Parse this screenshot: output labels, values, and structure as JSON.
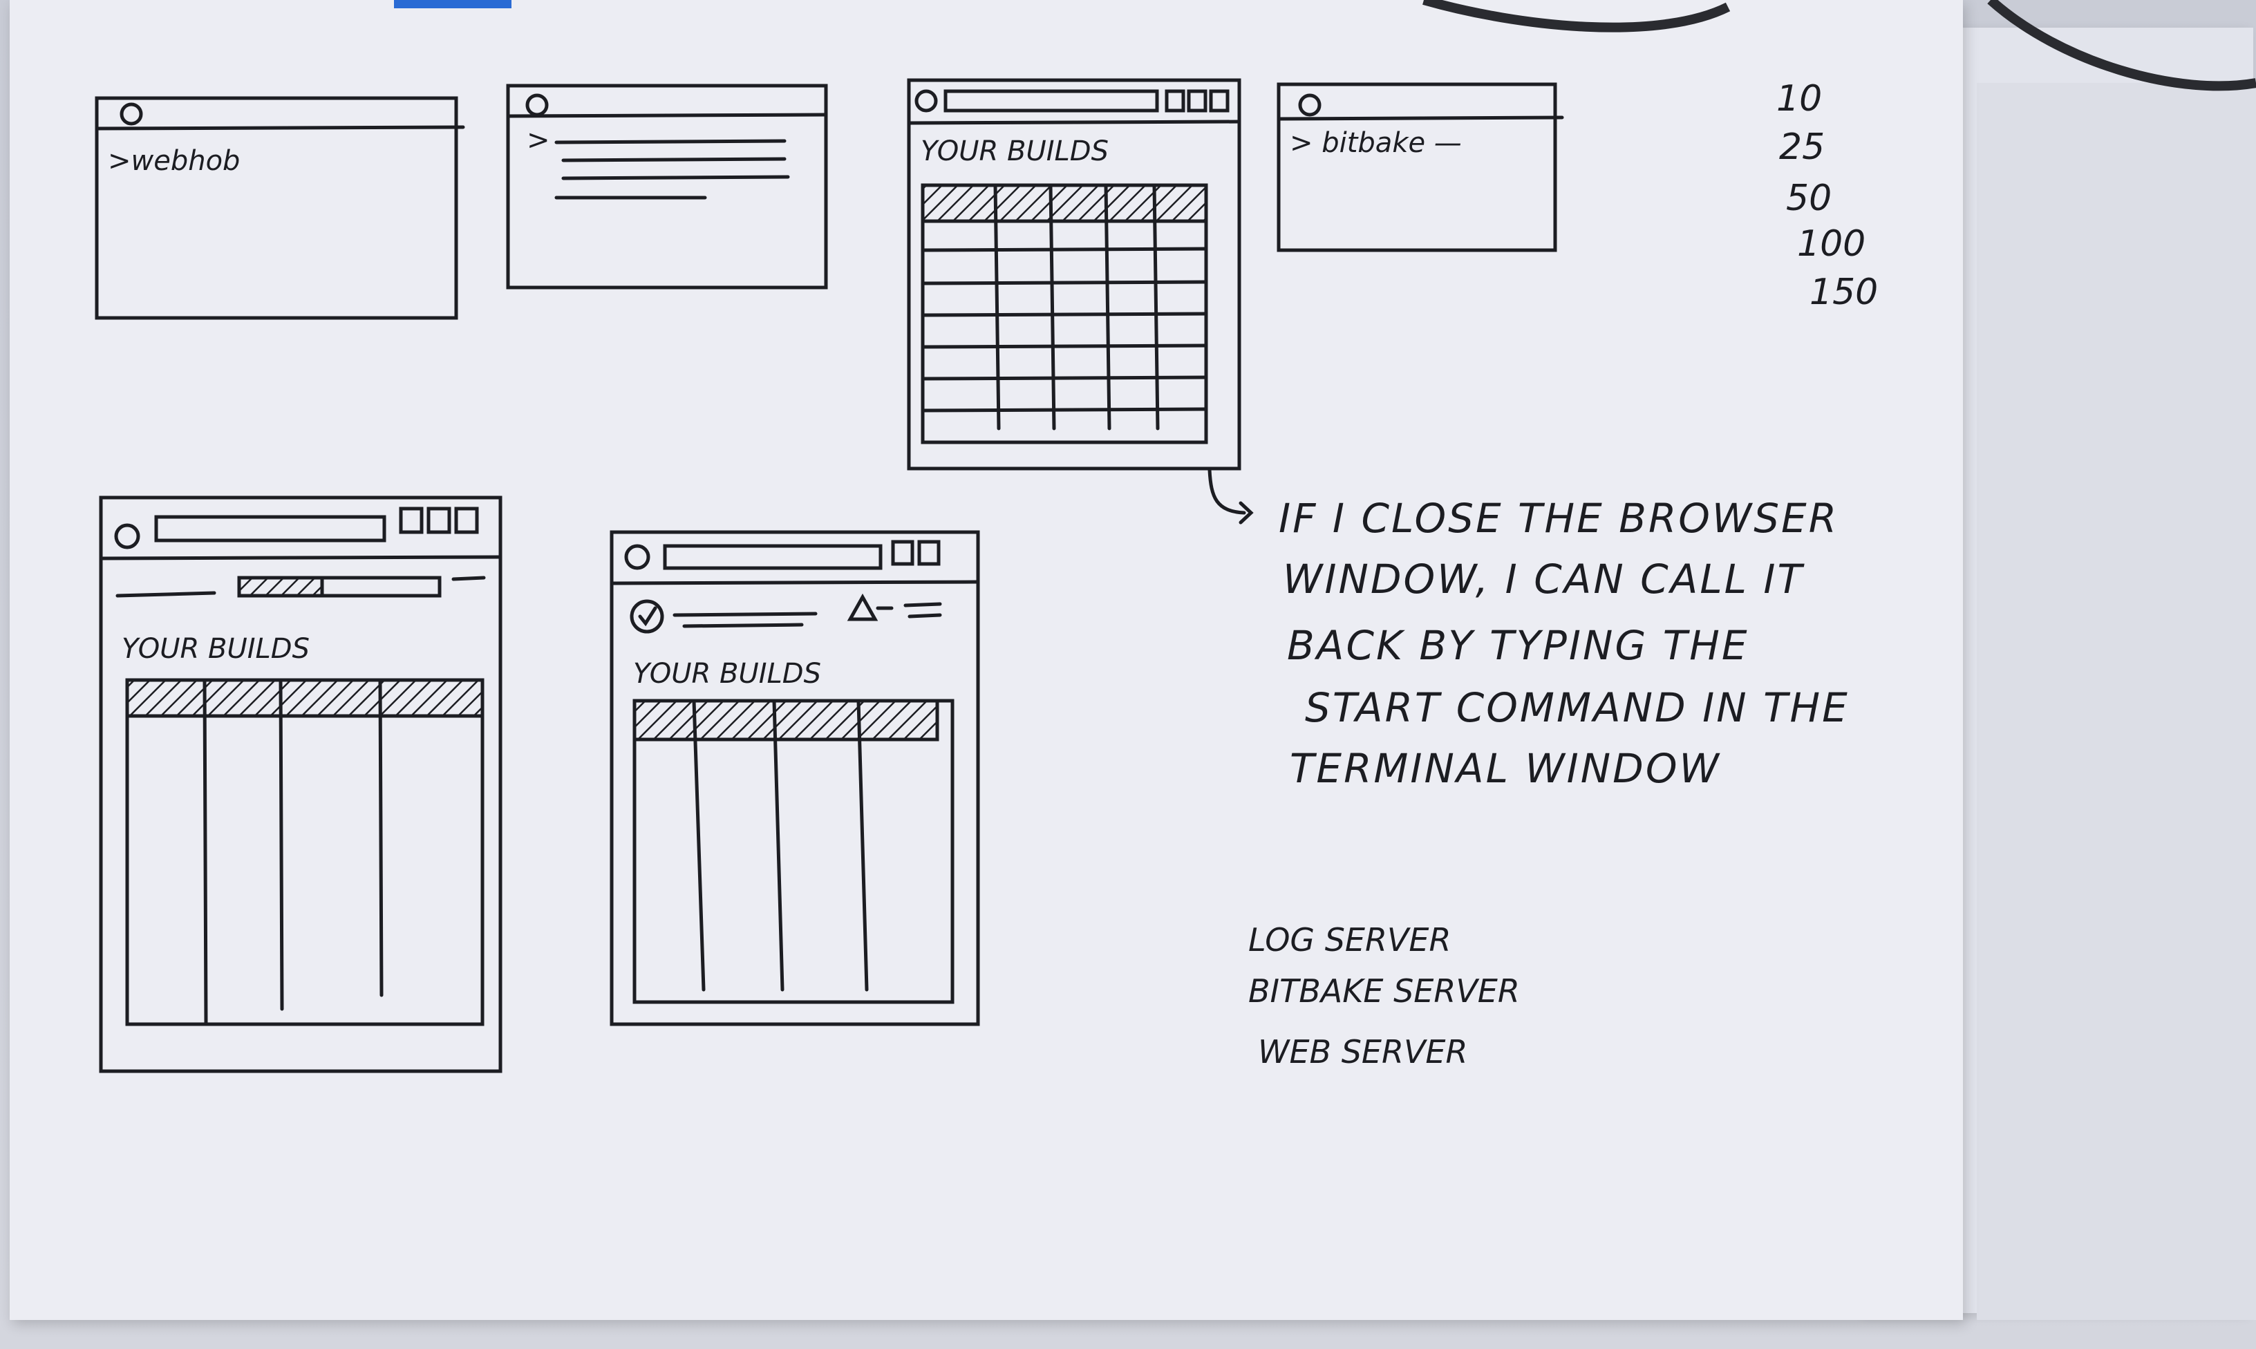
{
  "sketches": {
    "terminal_1": {
      "command": ">webhob"
    },
    "terminal_2": {
      "prompt": ">"
    },
    "browser_1": {
      "heading": "YOUR BUILDS"
    },
    "terminal_3": {
      "command": "> bitbake —"
    },
    "browser_2": {
      "heading": "YOUR BUILDS"
    },
    "browser_3": {
      "heading": "YOUR BUILDS"
    }
  },
  "numbers": [
    "10",
    "25",
    "50",
    "100",
    "150"
  ],
  "note": {
    "lines": [
      "IF I CLOSE THE BROWSER",
      "WINDOW, I CAN CALL IT",
      "BACK BY TYPING THE",
      "START COMMAND IN THE",
      "TERMINAL WINDOW"
    ]
  },
  "servers": [
    "LOG SERVER",
    "BITBAKE SERVER",
    "WEB SERVER"
  ],
  "colors": {
    "ink": "#1c1d22",
    "paper": "#ecedf3",
    "tape": "#2a6bd4"
  }
}
